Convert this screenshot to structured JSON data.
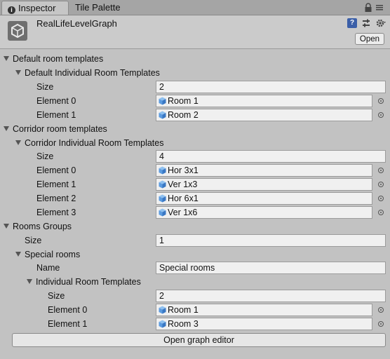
{
  "tabs": [
    {
      "label": "Inspector",
      "icon": "info-icon",
      "active": true
    },
    {
      "label": "Tile Palette",
      "active": false
    }
  ],
  "header": {
    "asset_name": "RealLifeLevelGraph",
    "open_label": "Open",
    "help_glyph": "?"
  },
  "sections": {
    "default_room_templates": "Default room templates",
    "default_individual": "Default Individual Room Templates",
    "corridor_room_templates": "Corridor room templates",
    "corridor_individual": "Corridor Individual Room Templates",
    "rooms_groups": "Rooms Groups",
    "special_rooms": "Special rooms",
    "individual": "Individual Room Templates"
  },
  "labels": {
    "size": "Size",
    "name": "Name",
    "element0": "Element 0",
    "element1": "Element 1",
    "element2": "Element 2",
    "element3": "Element 3"
  },
  "default_templates": {
    "size": "2",
    "elements": [
      "Room 1",
      "Room 2"
    ]
  },
  "corridor_templates": {
    "size": "4",
    "elements": [
      "Hor 3x1",
      "Ver 1x3",
      "Hor 6x1",
      "Ver 1x6"
    ]
  },
  "rooms_groups": {
    "size": "1",
    "special_rooms": {
      "name": "Special rooms",
      "size": "2",
      "elements": [
        "Room 1",
        "Room 3"
      ]
    }
  },
  "footer": {
    "open_graph_editor": "Open graph editor"
  },
  "colors": {
    "background": "#c2c2c2",
    "field": "#f0f0f0",
    "cube_top": "#8fc1f0",
    "cube_side": "#3a78c4"
  }
}
